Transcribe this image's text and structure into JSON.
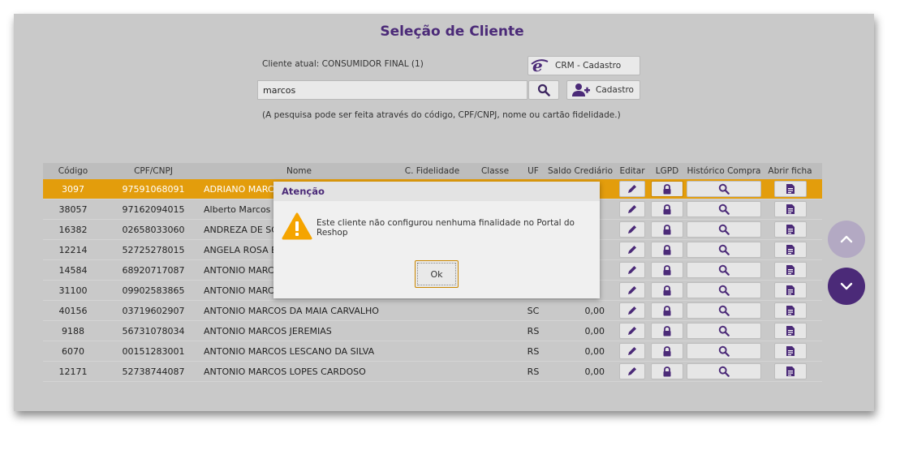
{
  "title": "Seleção de Cliente",
  "client_current": "Cliente atual: CONSUMIDOR FINAL (1)",
  "crm_button": "CRM - Cadastro",
  "cadastro_button": "Cadastro",
  "search": {
    "value": "marcos"
  },
  "hint": "(A pesquisa pode ser feita através do código, CPF/CNPJ, nome ou cartão fidelidade.)",
  "columns": [
    "Código",
    "CPF/CNPJ",
    "Nome",
    "C. Fidelidade",
    "Classe",
    "UF",
    "Saldo Crediário",
    "Editar",
    "LGPD",
    "Histórico Compra",
    "Abrir ficha"
  ],
  "rows": [
    {
      "code": "3097",
      "cpf": "97591068091",
      "name": "ADRIANO MARCO",
      "uf": "",
      "saldo": ""
    },
    {
      "code": "38057",
      "cpf": "97162094015",
      "name": "Alberto Marcos M",
      "uf": "",
      "saldo": ""
    },
    {
      "code": "16382",
      "cpf": "02658033060",
      "name": "ANDREZA DE SOU",
      "uf": "",
      "saldo": ""
    },
    {
      "code": "12214",
      "cpf": "52725278015",
      "name": "ANGELA ROSA BA",
      "uf": "",
      "saldo": ""
    },
    {
      "code": "14584",
      "cpf": "68920717087",
      "name": "ANTONIO MARCO",
      "uf": "",
      "saldo": ""
    },
    {
      "code": "31100",
      "cpf": "09902583865",
      "name": "ANTONIO MARCO",
      "uf": "",
      "saldo": ""
    },
    {
      "code": "40156",
      "cpf": "03719602907",
      "name": "ANTONIO MARCOS DA MAIA CARVALHO",
      "uf": "SC",
      "saldo": "0,00"
    },
    {
      "code": "9188",
      "cpf": "56731078034",
      "name": "ANTONIO MARCOS JEREMIAS",
      "uf": "RS",
      "saldo": "0,00"
    },
    {
      "code": "6070",
      "cpf": "00151283001",
      "name": "ANTONIO MARCOS LESCANO DA SILVA",
      "uf": "RS",
      "saldo": "0,00"
    },
    {
      "code": "12171",
      "cpf": "52738744087",
      "name": "ANTONIO MARCOS LOPES CARDOSO",
      "uf": "RS",
      "saldo": "0,00"
    }
  ],
  "modal": {
    "title": "Atenção",
    "message": "Este cliente não configurou nenhuma finalidade no Portal do Reshop",
    "ok": "Ok"
  },
  "icons": {
    "search": "search-icon",
    "crm": "ie-logo-icon",
    "add_user": "add-user-icon",
    "edit": "pencil-icon",
    "lgpd": "lock-icon",
    "history": "search-icon",
    "ficha": "document-icon",
    "warning": "warning-icon",
    "nav_up": "chevron-up-icon",
    "nav_down": "chevron-down-icon"
  },
  "colors": {
    "accent": "#4b2a78",
    "selected_row": "#e39d0c",
    "warning": "#f5a400"
  }
}
